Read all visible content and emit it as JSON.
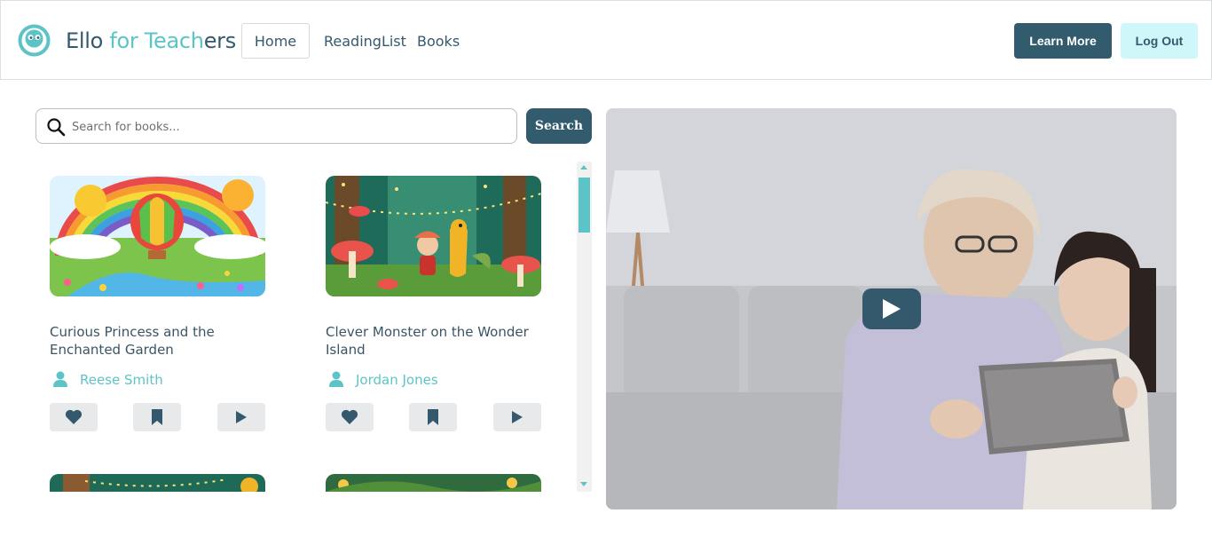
{
  "header": {
    "brand_part1": "Ello ",
    "brand_part2": "for Teach",
    "brand_part3": "ers",
    "nav": {
      "home": "Home",
      "reading_list": "ReadingList",
      "books": "Books"
    },
    "learn_more": "Learn More",
    "log_out": "Log Out"
  },
  "search": {
    "placeholder": "Search for books...",
    "button": "Search"
  },
  "books": [
    {
      "title": "Curious Princess and the Enchanted Garden",
      "author": "Reese Smith"
    },
    {
      "title": "Clever Monster on the Wonder Island",
      "author": "Jordan Jones"
    }
  ],
  "icons": {
    "logo": "ello-logo-icon",
    "search": "search-icon",
    "author": "person-icon",
    "like": "heart-icon",
    "bookmark": "bookmark-icon",
    "play": "play-icon"
  },
  "colors": {
    "primary": "#335b6e",
    "accent": "#5cc4c7",
    "logout_bg": "#cff6f8"
  }
}
